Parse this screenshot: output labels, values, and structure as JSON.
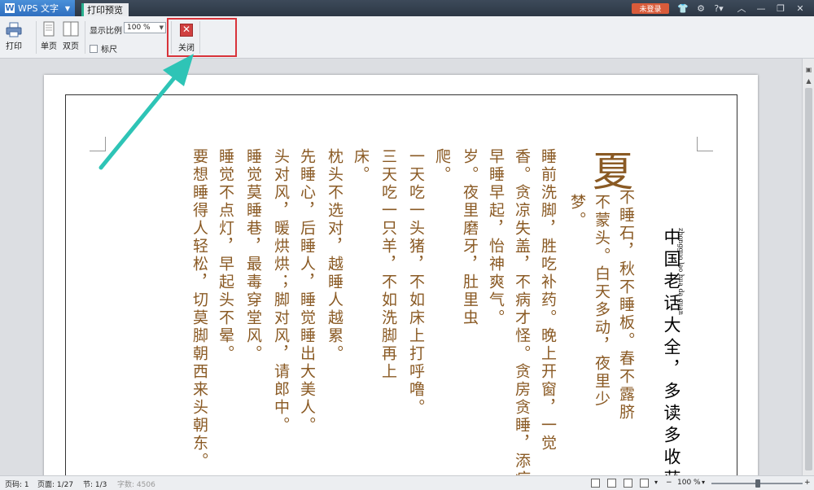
{
  "titlebar": {
    "app_name": "WPS 文字",
    "app_logo": "W",
    "doc_tab": "打印预览",
    "login": "未登录",
    "icons": [
      "skin-icon",
      "settings-icon",
      "help-icon",
      "collapse-icon",
      "restore-icon",
      "close-icon"
    ]
  },
  "toolbar": {
    "print_label": "打印",
    "single_page_label": "单页",
    "double_page_label": "双页",
    "zoom_label": "显示比例",
    "zoom_value": "100 %",
    "ruler_label": "标尺",
    "close_label": "关闭"
  },
  "document": {
    "title": "中国老话大全，多读多收获啊",
    "pinyin": "zhongguo lao hua da quan",
    "big_char": "夏",
    "columns": [
      "不睡石，秋不睡板。春不露脐",
      "不蒙头。白天多动，夜里少",
      "梦。",
      "睡前洗脚，胜吃补药。晚上开窗，一觉",
      "香。贪凉失盖，不病才怪。贪房贪睡，添病",
      "早睡早起，怡神爽气。",
      "岁。夜里磨牙，肚里虫",
      "爬。",
      "一天吃一头猪，不如床上打呼噜。",
      "三天吃一只羊，不如洗脚再上",
      "床。",
      "枕头不选对，越睡人越累。",
      "先睡心，后睡人，睡觉睡出大美人。",
      "头对风，暖烘烘；脚对风，请郎中。",
      "睡觉莫睡巷，最毒穿堂风。",
      "睡觉不点灯，早起头不晕。",
      "要想睡得人轻松，切莫脚朝西来头朝东。"
    ]
  },
  "statusbar": {
    "page_code": "页码: 1",
    "page": "页面: 1/27",
    "section": "节: 1/3",
    "word_count": "字数: 4506",
    "zoom": "100 %"
  },
  "colors": {
    "text_brown": "#8a5a24",
    "highlight_red": "#d8333a",
    "arrow_teal": "#2ec4b6"
  }
}
